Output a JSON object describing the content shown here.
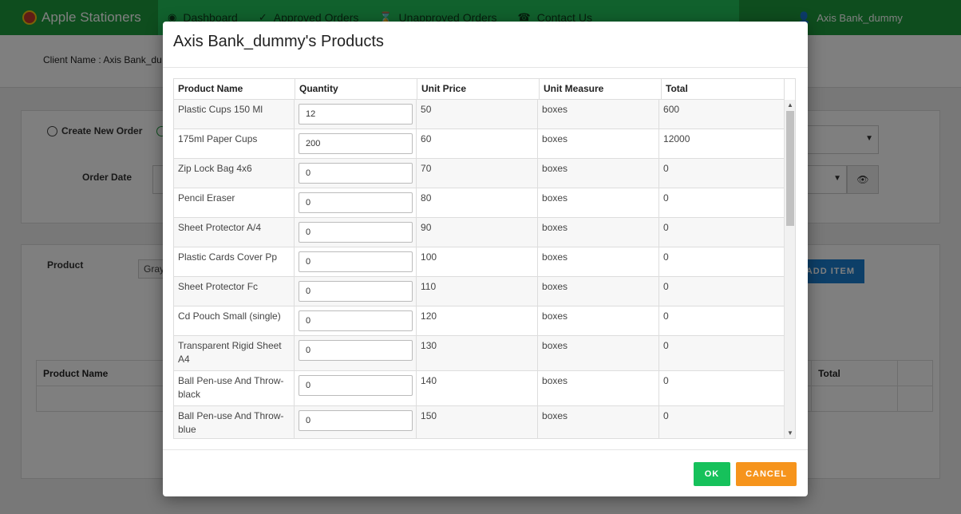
{
  "app": {
    "brand": "Apple Stationers",
    "user": "Axis Bank_dummy"
  },
  "nav": [
    {
      "icon": "dashboard-icon",
      "label": "Dashboard"
    },
    {
      "icon": "check-circle-icon",
      "label": "Approved Orders"
    },
    {
      "icon": "hourglass-icon",
      "label": "Unapproved Orders"
    },
    {
      "icon": "phone-icon",
      "label": "Contact Us"
    }
  ],
  "background": {
    "client_name": "Client Name : Axis Bank_du",
    "create_new_order": "Create New Order",
    "order_date_label": "Order Date",
    "product_label": "Product",
    "product_input": "Gray",
    "add_item": "ADD ITEM",
    "table_product_name": "Product Name",
    "table_total": "Total"
  },
  "modal": {
    "title": "Axis Bank_dummy's Products",
    "columns": [
      "Product Name",
      "Quantity",
      "Unit Price",
      "Unit Measure",
      "Total"
    ],
    "rows": [
      {
        "name": "Plastic Cups 150 Ml",
        "qty": "12",
        "price": "50",
        "measure": "boxes",
        "total": "600"
      },
      {
        "name": "175ml Paper Cups",
        "qty": "200",
        "price": "60",
        "measure": "boxes",
        "total": "12000"
      },
      {
        "name": "Zip Lock Bag 4x6",
        "qty": "0",
        "price": "70",
        "measure": "boxes",
        "total": "0"
      },
      {
        "name": "Pencil Eraser",
        "qty": "0",
        "price": "80",
        "measure": "boxes",
        "total": "0"
      },
      {
        "name": "Sheet Protector A/4",
        "qty": "0",
        "price": "90",
        "measure": "boxes",
        "total": "0"
      },
      {
        "name": "Plastic Cards Cover Pp",
        "qty": "0",
        "price": "100",
        "measure": "boxes",
        "total": "0"
      },
      {
        "name": "Sheet Protector Fc",
        "qty": "0",
        "price": "110",
        "measure": "boxes",
        "total": "0"
      },
      {
        "name": "Cd Pouch Small (single)",
        "qty": "0",
        "price": "120",
        "measure": "boxes",
        "total": "0"
      },
      {
        "name": "Transparent Rigid Sheet A4",
        "qty": "0",
        "price": "130",
        "measure": "boxes",
        "total": "0"
      },
      {
        "name": "Ball Pen-use And Throw-black",
        "qty": "0",
        "price": "140",
        "measure": "boxes",
        "total": "0"
      },
      {
        "name": "Ball Pen-use And Throw-blue",
        "qty": "0",
        "price": "150",
        "measure": "boxes",
        "total": "0"
      }
    ],
    "ok": "OK",
    "cancel": "CANCEL"
  }
}
